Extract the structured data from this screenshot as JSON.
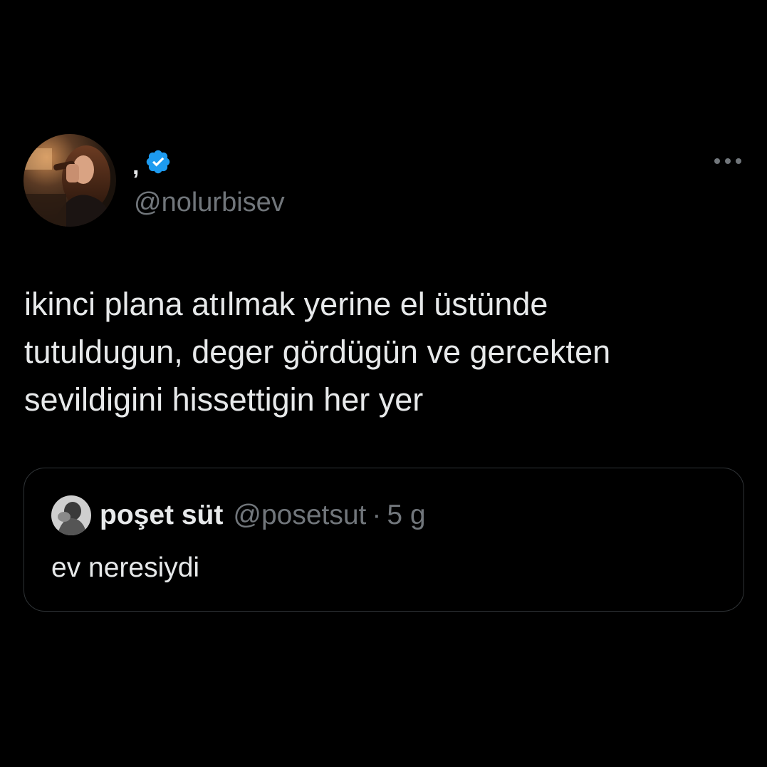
{
  "tweet": {
    "author": {
      "display_name": ",",
      "handle": "@nolurbisev",
      "verified": true,
      "avatar_icon": "profile-photo-woman-drinking"
    },
    "more_icon": "more-horizontal-icon",
    "text": "ikinci plana atılmak yerine el üstünde\ntutuldugun, deger gördügün ve gercekten\nsevildigini hissettigin her yer",
    "quote": {
      "author_name": "poşet süt",
      "handle": "@posetsut",
      "separator": "·",
      "time": "5 g",
      "avatar_icon": "profile-photo-grayscale",
      "text": "ev neresiydi"
    }
  },
  "colors": {
    "background": "#000000",
    "primary_text": "#e7e9ea",
    "secondary_text": "#71767b",
    "border": "#2f3336",
    "verified_blue": "#1d9bf0"
  }
}
